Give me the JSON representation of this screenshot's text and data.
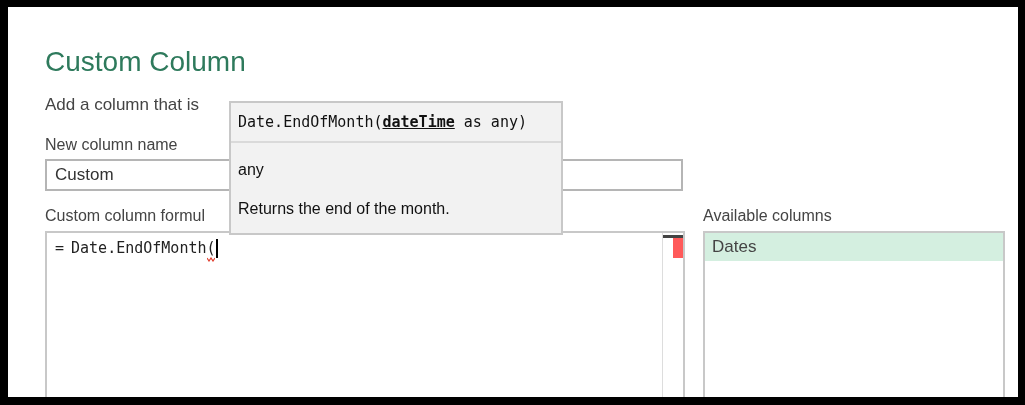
{
  "dialog": {
    "title": "Custom Column",
    "subtitle": "Add a column that is"
  },
  "new_column": {
    "label": "New column name",
    "value": "Custom"
  },
  "formula": {
    "label": "Custom column formul",
    "prefix": "=",
    "text": "Date.EndOfMonth("
  },
  "tooltip": {
    "signature": "Date.EndOfMonth(**dateTime** as any)",
    "return_type": "any",
    "description": "Returns the end of the month."
  },
  "available_columns": {
    "label": "Available columns",
    "items": [
      {
        "label": "Dates",
        "selected": true
      }
    ]
  }
}
